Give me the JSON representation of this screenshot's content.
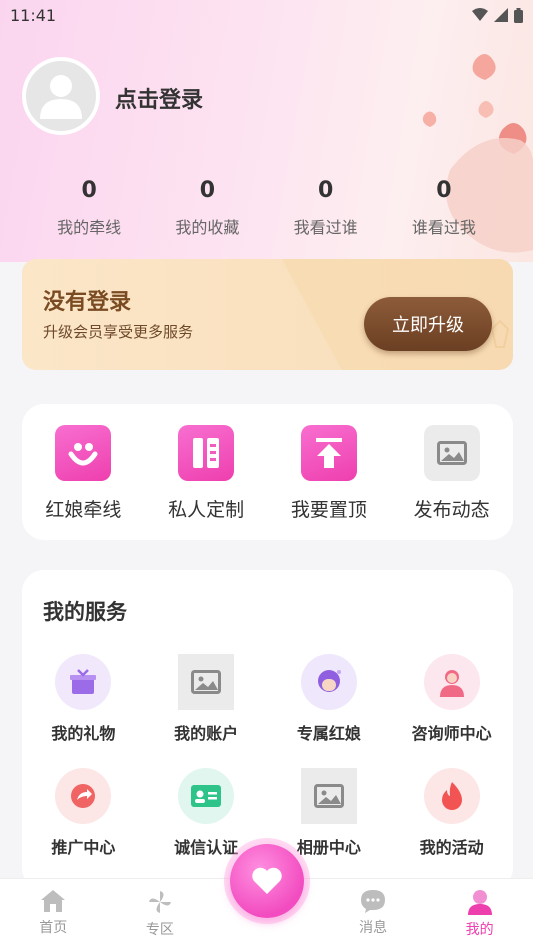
{
  "status_bar": {
    "time": "11:41"
  },
  "profile": {
    "login_prompt": "点击登录"
  },
  "stats": [
    {
      "value": "0",
      "label": "我的牵线"
    },
    {
      "value": "0",
      "label": "我的收藏"
    },
    {
      "value": "0",
      "label": "我看过谁"
    },
    {
      "value": "0",
      "label": "谁看过我"
    }
  ],
  "vip": {
    "title": "没有登录",
    "subtitle": "升级会员享受更多服务",
    "button": "立即升级"
  },
  "quick_actions": [
    {
      "label": "红娘牵线",
      "icon": "matchmaker-icon"
    },
    {
      "label": "私人定制",
      "icon": "custom-icon"
    },
    {
      "label": "我要置顶",
      "icon": "pin-top-icon"
    },
    {
      "label": "发布动态",
      "icon": "image-placeholder-icon"
    }
  ],
  "services": {
    "title": "我的服务",
    "items": [
      {
        "label": "我的礼物",
        "icon": "gift-icon"
      },
      {
        "label": "我的账户",
        "icon": "image-placeholder-icon"
      },
      {
        "label": "专属红娘",
        "icon": "matchmaker-avatar-icon"
      },
      {
        "label": "咨询师中心",
        "icon": "counselor-icon"
      },
      {
        "label": "推广中心",
        "icon": "share-icon"
      },
      {
        "label": "诚信认证",
        "icon": "id-card-icon"
      },
      {
        "label": "相册中心",
        "icon": "image-placeholder-icon"
      },
      {
        "label": "我的活动",
        "icon": "flame-icon"
      }
    ]
  },
  "tabbar": [
    {
      "label": "首页",
      "icon": "home-icon"
    },
    {
      "label": "专区",
      "icon": "pinwheel-icon"
    },
    {
      "label": "",
      "icon": "heart-icon"
    },
    {
      "label": "消息",
      "icon": "message-icon"
    },
    {
      "label": "我的",
      "icon": "profile-icon",
      "active": true
    }
  ],
  "colors": {
    "accent": "#ee3fae",
    "vip_brown": "#7a4b22"
  }
}
